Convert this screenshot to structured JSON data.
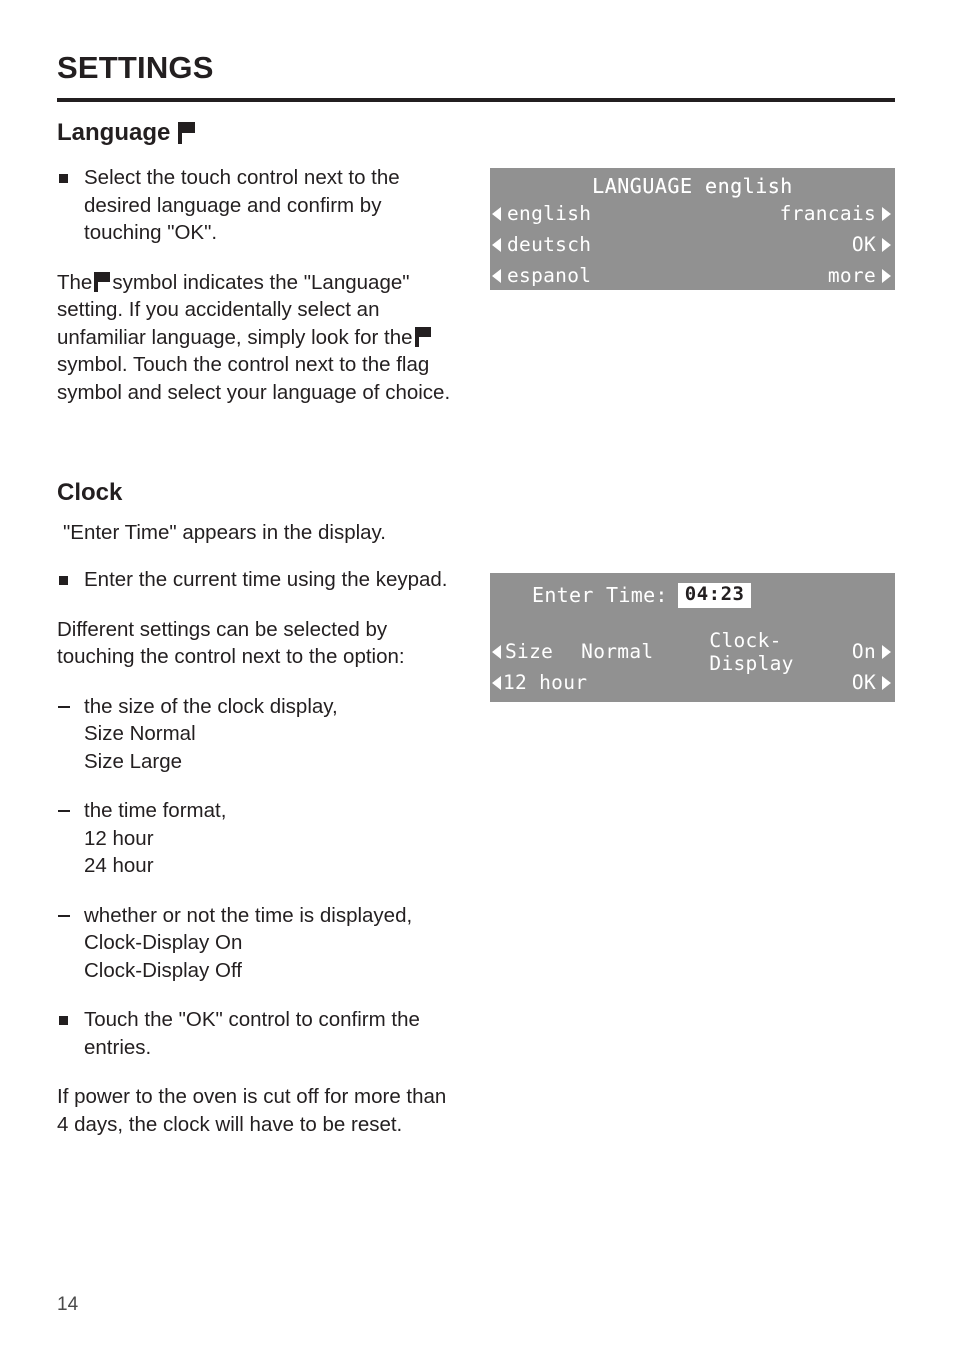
{
  "document": {
    "chapter_title": "SETTINGS",
    "page_number": "14"
  },
  "language_section": {
    "heading": "Language",
    "flag_icon": "flag-icon",
    "bullet_1": "Select the touch control next to the desired language and confirm by touching \"OK\".",
    "paragraph_1_part_a": "The",
    "paragraph_1_part_b": "symbol indicates the \"Language\" setting. If you accidentally select an unfamiliar language, simply look for the",
    "paragraph_1_part_c": "symbol. Touch the control next to the flag symbol and select your language of choice."
  },
  "language_display": {
    "title": "LANGUAGE english",
    "rows": [
      {
        "left_label": "english",
        "right_label": "francais"
      },
      {
        "left_label": "deutsch",
        "right_label": "OK"
      },
      {
        "left_label": "espanol",
        "right_label": "more"
      }
    ],
    "left_arrow_icon": "triangle-left-icon",
    "right_arrow_icon": "triangle-right-icon",
    "background_color": "#919191",
    "text_color": "#ffffff"
  },
  "clock_section": {
    "heading": "Clock",
    "intro": "\"Enter Time\" appears in the display.",
    "bullet_1": "Enter the current time using the keypad.",
    "paragraph_1": "Different settings can be selected by touching the control next to the option:",
    "options": [
      {
        "description": "the size of the clock display,",
        "values": [
          "Size Normal",
          "Size Large"
        ]
      },
      {
        "description": "the time format,",
        "values": [
          "12 hour",
          "24 hour"
        ]
      },
      {
        "description": "whether or not the time is displayed,",
        "values": [
          "Clock-Display On",
          "Clock-Display Off"
        ]
      }
    ],
    "bullet_2": "Touch the \"OK\" control to confirm the entries.",
    "paragraph_2": "If power to the oven is cut off for more than 4 days, the clock will have to be reset."
  },
  "clock_display": {
    "enter_time_label": "Enter Time:",
    "time_value": "04:23",
    "size_label": "Size",
    "size_value": "Normal",
    "clock_display_label": "Clock-Display",
    "clock_display_value": "On",
    "time_format_label": "12 hour",
    "ok_label": "OK",
    "left_arrow_icon": "triangle-left-icon",
    "right_arrow_icon": "triangle-right-icon",
    "background_color": "#919191",
    "text_color": "#ffffff",
    "highlight_background": "#ffffff",
    "highlight_text_color": "#231f20"
  }
}
